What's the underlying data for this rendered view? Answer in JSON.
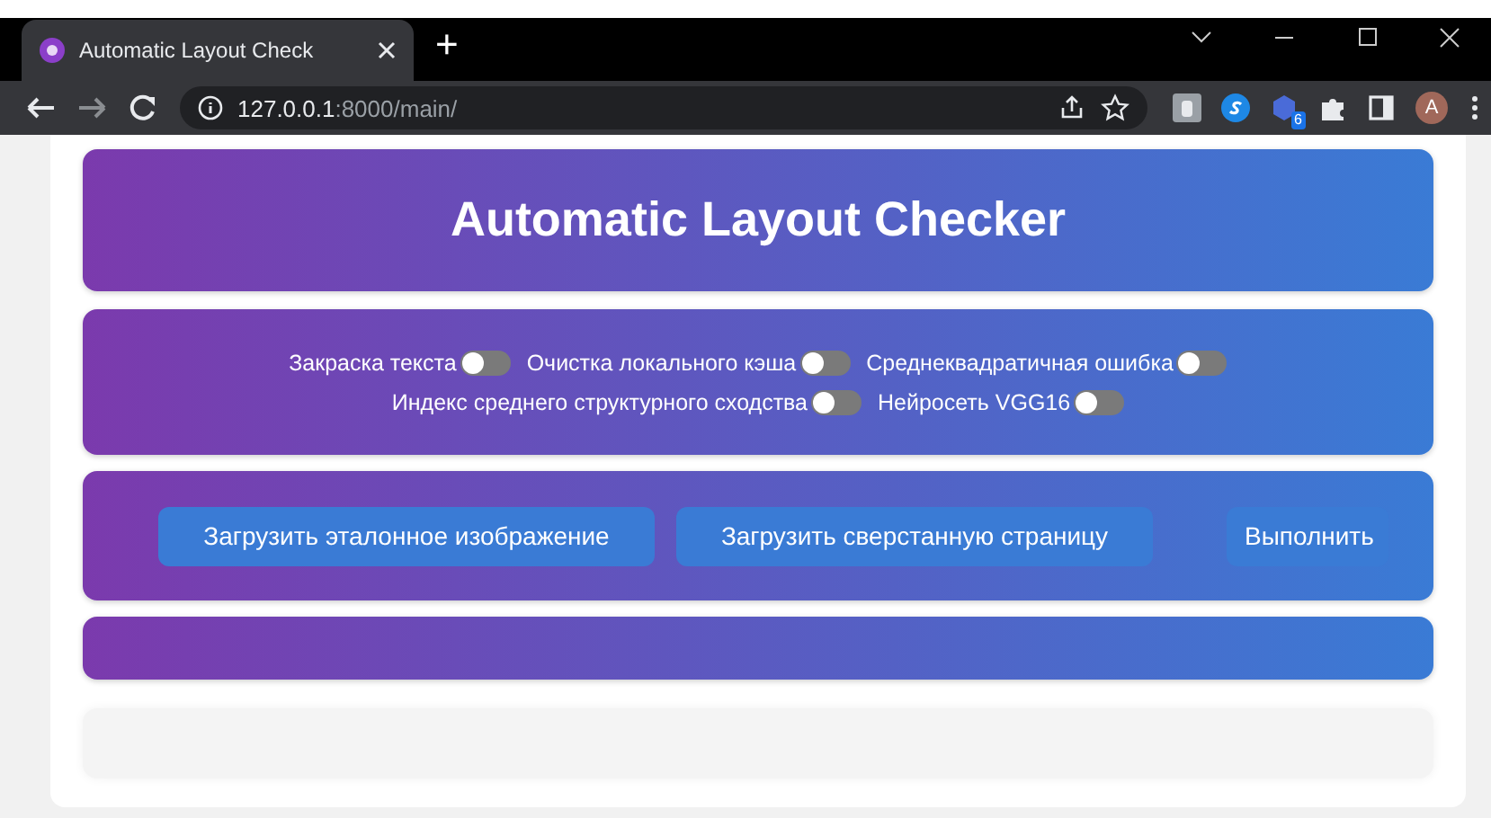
{
  "browser": {
    "tab_title": "Automatic Layout Check",
    "new_tab": "+",
    "url_host": "127.0.0.1",
    "url_path": ":8000/main/",
    "extension_badge": "6",
    "avatar": "A"
  },
  "header": {
    "title": "Automatic Layout Checker"
  },
  "options": [
    {
      "label": "Закраска текста",
      "on": false
    },
    {
      "label": "Очистка локального кэша",
      "on": false
    },
    {
      "label": "Среднеквадратичная ошибка",
      "on": false
    },
    {
      "label": "Индекс среднего структурного сходства",
      "on": false
    },
    {
      "label": "Нейросеть VGG16",
      "on": false
    }
  ],
  "actions": [
    "Загрузить эталонное изображение",
    "Загрузить сверстанную страницу",
    "Выполнить"
  ]
}
